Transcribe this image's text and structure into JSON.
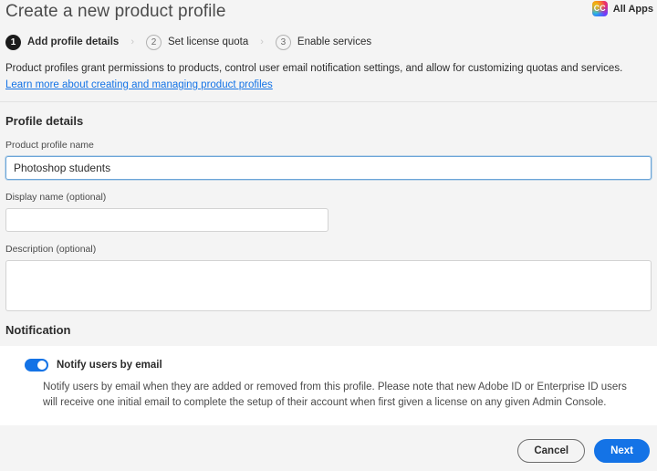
{
  "header": {
    "title": "Create a new product profile",
    "product_badge": {
      "icon": "creative-cloud-icon",
      "glyph": "CC",
      "label": "All Apps"
    }
  },
  "stepper": {
    "separator": "›",
    "steps": [
      {
        "number": "1",
        "label": "Add profile details",
        "state": "active"
      },
      {
        "number": "2",
        "label": "Set license quota",
        "state": "inactive"
      },
      {
        "number": "3",
        "label": "Enable services",
        "state": "inactive"
      }
    ]
  },
  "intro": {
    "text": "Product profiles grant permissions to products, control user email notification settings, and allow for customizing quotas and services.",
    "link": "Learn more about creating and managing product profiles"
  },
  "profile_details": {
    "section_title": "Profile details",
    "fields": {
      "profile_name": {
        "label": "Product profile name",
        "value": "Photoshop students",
        "placeholder": "",
        "focused": true
      },
      "display_name": {
        "label": "Display name (optional)",
        "value": "",
        "placeholder": ""
      },
      "description": {
        "label": "Description (optional)",
        "value": "",
        "placeholder": ""
      }
    }
  },
  "notification": {
    "section_title": "Notification",
    "toggle": {
      "label": "Notify users by email",
      "state": "on"
    },
    "description": "Notify users by email when they are added or removed from this profile. Please note that new Adobe ID or Enterprise ID users will receive one initial email to complete the setup of their account when first given a license on any given Admin Console."
  },
  "footer": {
    "cancel_label": "Cancel",
    "next_label": "Next"
  },
  "colors": {
    "accent_blue": "#1473e6",
    "page_background": "#f4f4f4",
    "card_background": "#ffffff",
    "text_primary": "#2c2c2c",
    "text_secondary": "#4b4b4b",
    "border": "#d3d3d3",
    "focus_border": "#6ba5d8",
    "step_active": "#1b1b1b"
  }
}
